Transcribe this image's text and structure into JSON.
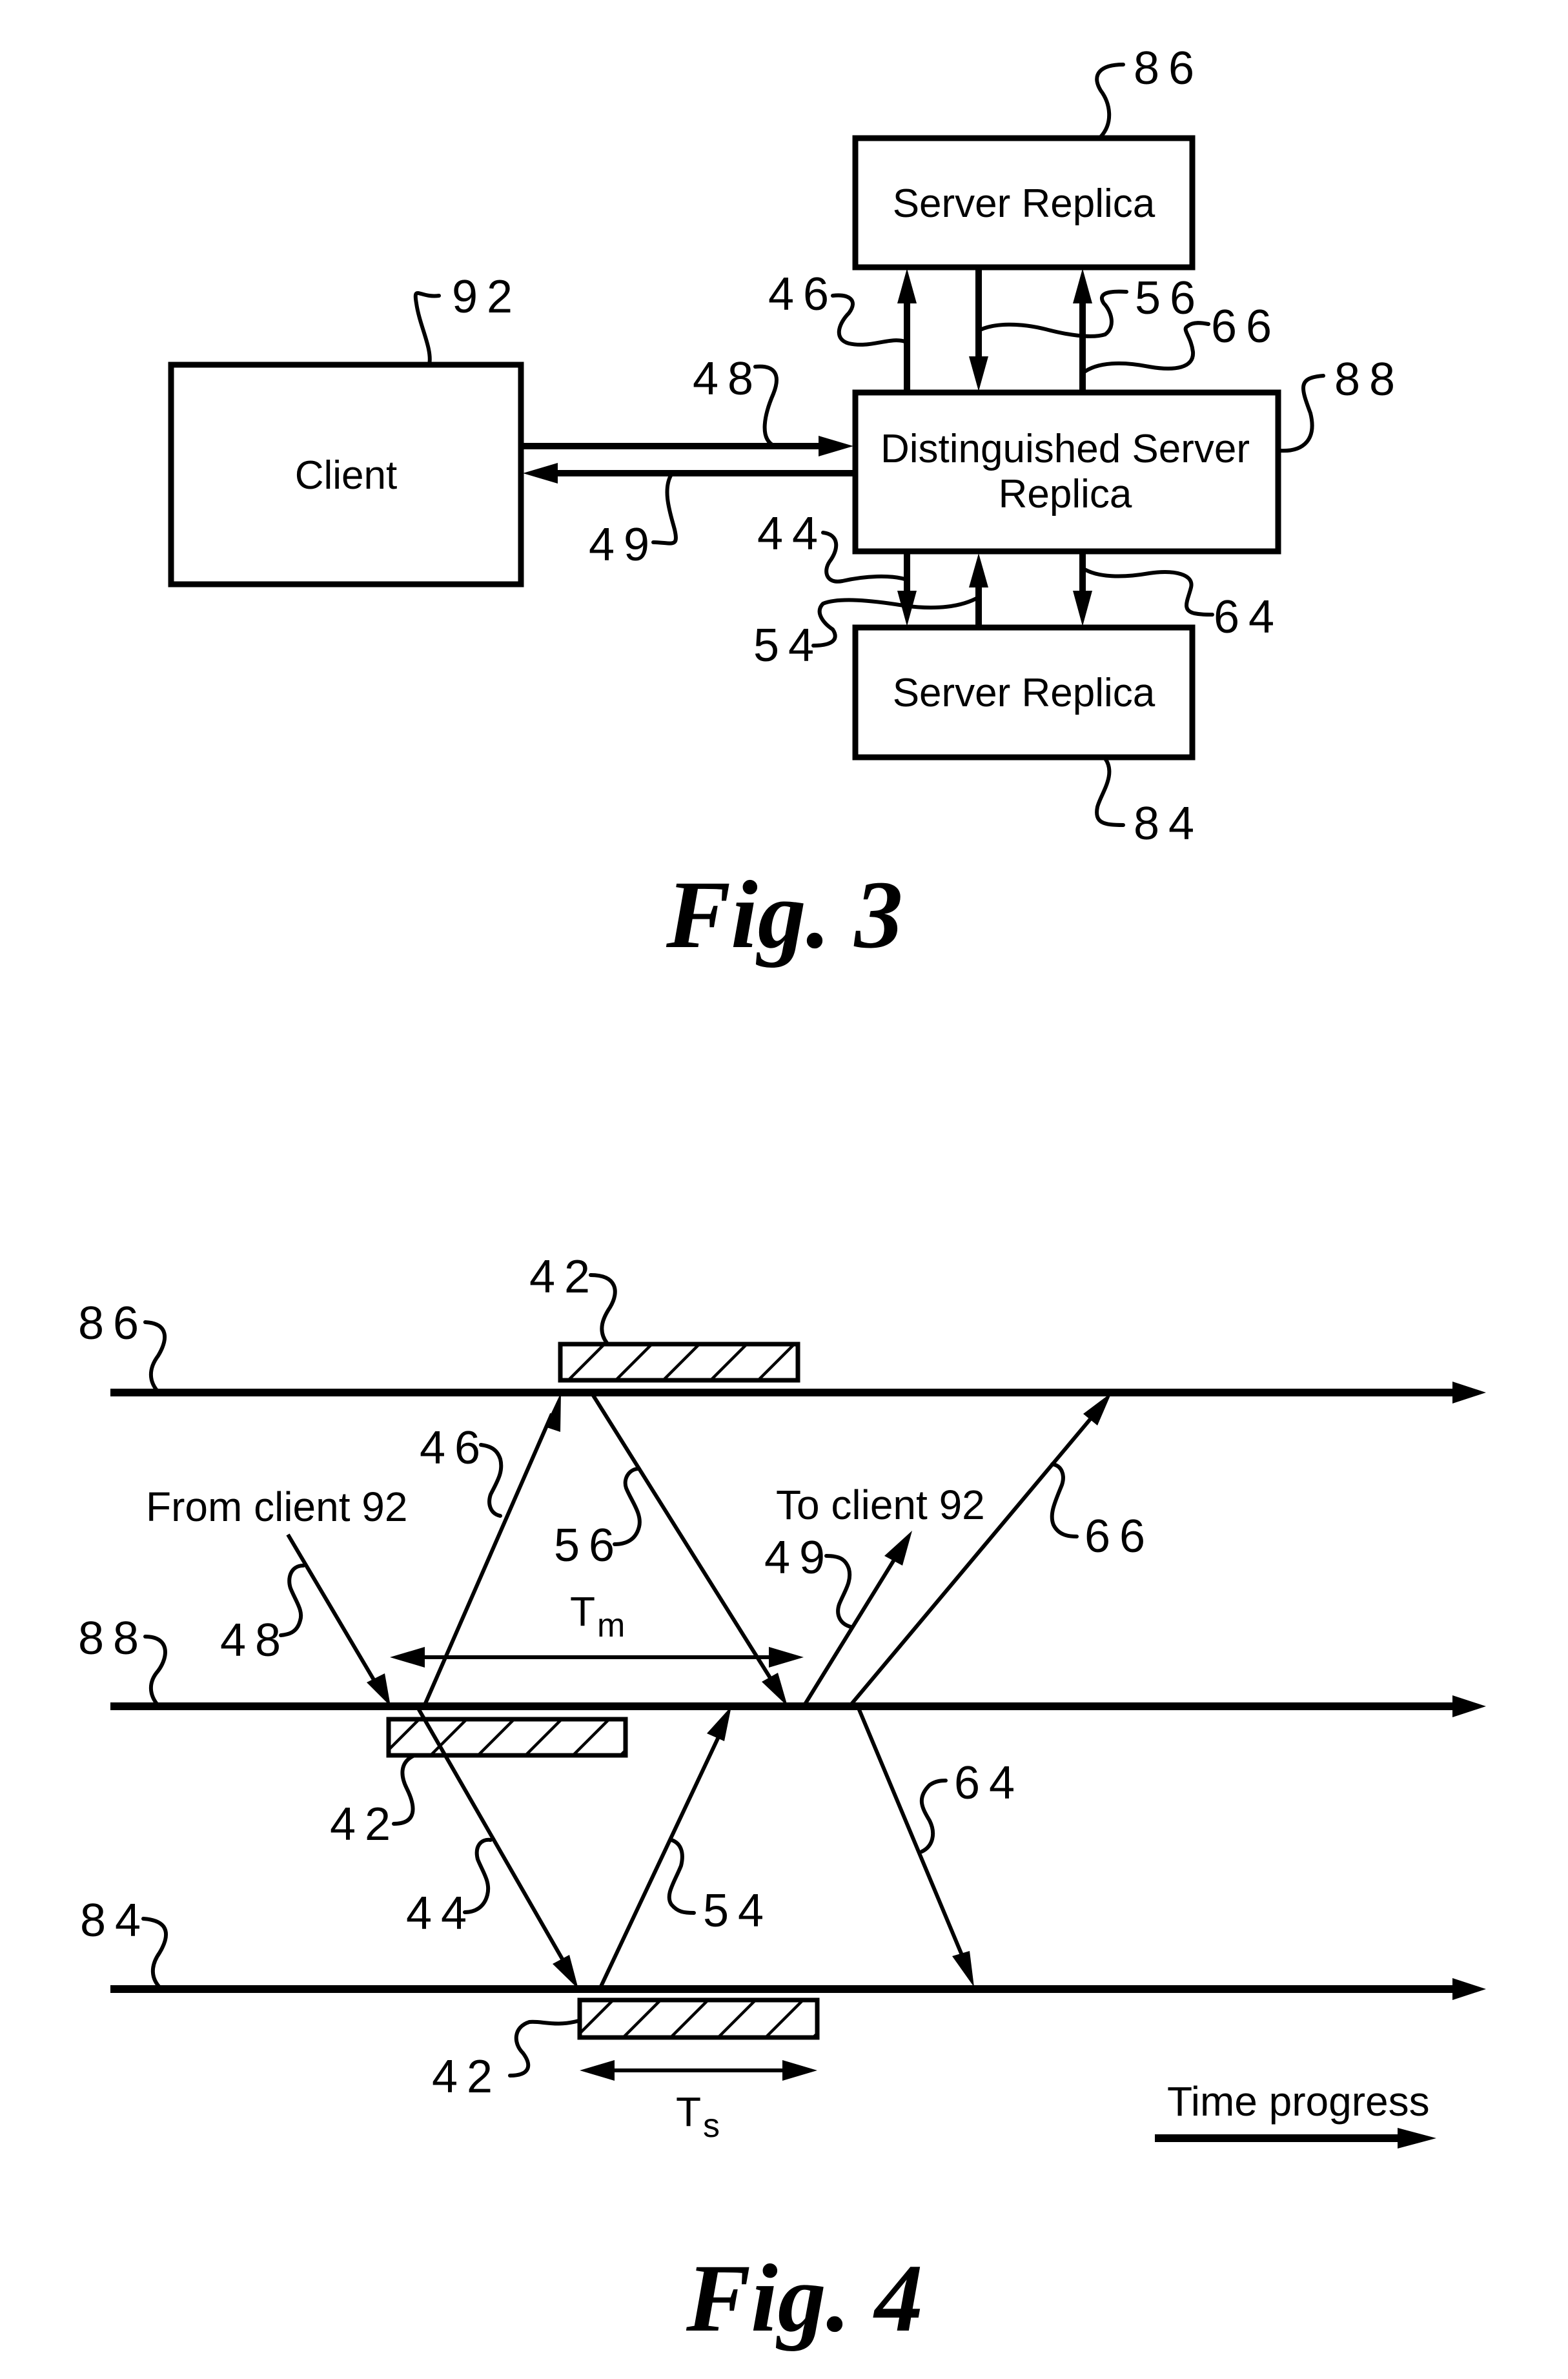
{
  "fig3": {
    "caption": "Fig.  3",
    "boxes": {
      "client": "Client",
      "top_server": "Server Replica",
      "distinguished_line1": "Distinguished Server",
      "distinguished_line2": "Replica",
      "bottom_server": "Server Replica"
    },
    "refs": {
      "client": "92",
      "top_server": "86",
      "distinguished": "88",
      "bottom_server": "84",
      "msg_46": "46",
      "msg_56": "56",
      "msg_66": "66",
      "msg_48": "48",
      "msg_49": "49",
      "msg_44": "44",
      "msg_54": "54",
      "msg_64": "64"
    }
  },
  "fig4": {
    "caption": "Fig.  4",
    "timelines": [
      {
        "ref": "86",
        "name": "server-replica-86"
      },
      {
        "ref": "88",
        "name": "distinguished-server-88"
      },
      {
        "ref": "84",
        "name": "server-replica-84"
      }
    ],
    "processing_ref": "42",
    "labels": {
      "from_client": "From client 92",
      "to_client": "To client 92",
      "tm_main": "T",
      "tm_sub": "m",
      "ts_main": "T",
      "ts_sub": "s",
      "time_progress": "Time progress"
    },
    "refs": {
      "msg_46": "46",
      "msg_56": "56",
      "msg_48": "48",
      "msg_49": "49",
      "msg_66": "66",
      "msg_44": "44",
      "msg_54": "54",
      "msg_64": "64",
      "proc_top": "42",
      "proc_mid": "42",
      "proc_bot": "42"
    }
  }
}
